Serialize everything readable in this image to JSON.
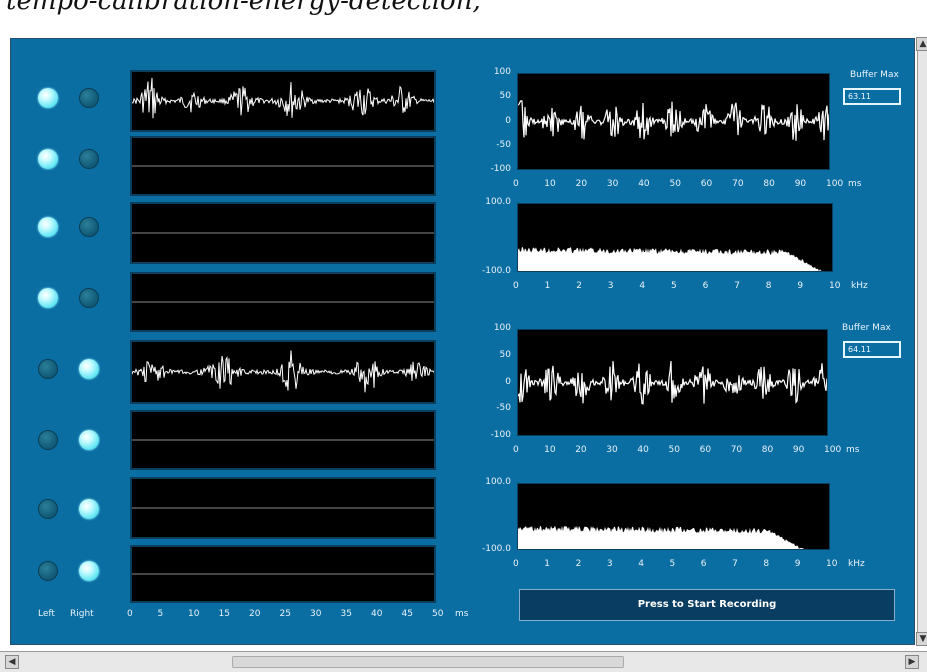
{
  "top_caption": "tempo-calibration-energy-detection,",
  "toolbar": {
    "run_icon": "arrow-right-icon",
    "run_continuous_icon": "run-continuous-icon",
    "abort_icon": "stop-icon",
    "pause_icon": "pause-icon"
  },
  "channels": {
    "leds": [
      {
        "left": true,
        "right": false
      },
      {
        "left": true,
        "right": false
      },
      {
        "left": true,
        "right": false
      },
      {
        "left": true,
        "right": false
      },
      {
        "left": false,
        "right": true
      },
      {
        "left": false,
        "right": true
      },
      {
        "left": false,
        "right": true
      },
      {
        "left": false,
        "right": true
      }
    ],
    "left_label": "Left",
    "right_label": "Right",
    "x_ticks": [
      "0",
      "5",
      "10",
      "15",
      "20",
      "25",
      "30",
      "35",
      "40",
      "45",
      "50"
    ],
    "x_unit": "ms"
  },
  "plots": {
    "time_top": {
      "y_ticks": [
        "100",
        "50",
        "0",
        "-50",
        "-100"
      ],
      "x_ticks": [
        "0",
        "10",
        "20",
        "30",
        "40",
        "50",
        "60",
        "70",
        "80",
        "90",
        "100"
      ],
      "x_unit": "ms"
    },
    "spec_top": {
      "y_ticks": [
        "100.0",
        "-100.0"
      ],
      "x_ticks": [
        "0",
        "1",
        "2",
        "3",
        "4",
        "5",
        "6",
        "7",
        "8",
        "9",
        "10"
      ],
      "x_unit": "kHz"
    },
    "time_bottom": {
      "y_ticks": [
        "100",
        "50",
        "0",
        "-50",
        "-100"
      ],
      "x_ticks": [
        "0",
        "10",
        "20",
        "30",
        "40",
        "50",
        "60",
        "70",
        "80",
        "90",
        "100"
      ],
      "x_unit": "ms"
    },
    "spec_bottom": {
      "y_ticks": [
        "100.0",
        "-100.0"
      ],
      "x_ticks": [
        "0",
        "1",
        "2",
        "3",
        "4",
        "5",
        "6",
        "7",
        "8",
        "9",
        "10"
      ],
      "x_unit": "kHz"
    }
  },
  "buffer_top": {
    "label": "Buffer Max",
    "value": "63.11"
  },
  "buffer_bottom": {
    "label": "Buffer Max",
    "value": "64.11"
  },
  "record_button": "Press to Start Recording",
  "colors": {
    "panel": "#0a6ea3",
    "led_on": "#5ee6f3",
    "led_off": "#135e7b",
    "trace": "#ffffff",
    "baseline": "#8a8a8a"
  }
}
